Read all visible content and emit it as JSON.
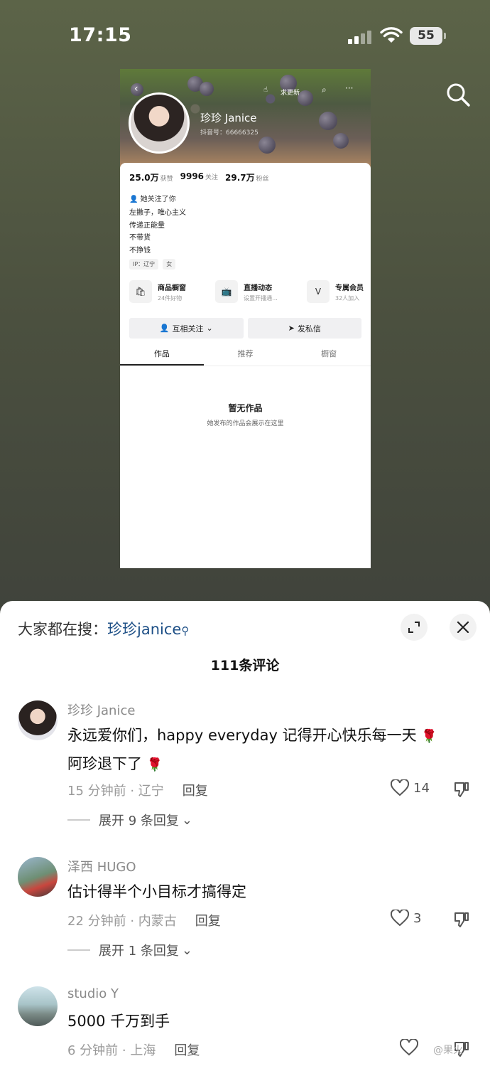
{
  "status_bar": {
    "time": "17:15",
    "battery": "55"
  },
  "profile": {
    "name": "珍珍 Janice",
    "id_label": "抖音号：66666325",
    "banner_action": "求更新",
    "stats": [
      {
        "value": "25.0万",
        "label": "获赞"
      },
      {
        "value": "9996",
        "label": "关注"
      },
      {
        "value": "29.7万",
        "label": "粉丝"
      }
    ],
    "follows_you": "她关注了你",
    "bio_lines": [
      "左撇子，唯心主义",
      "传递正能量",
      "不带货",
      "不挣钱"
    ],
    "tags": [
      "IP：辽宁",
      "女"
    ],
    "services": [
      {
        "title": "商品橱窗",
        "subtitle": "24件好物"
      },
      {
        "title": "直播动态",
        "subtitle": "设置开播通..."
      },
      {
        "title": "专属会员",
        "subtitle": "32人加入"
      }
    ],
    "buttons": {
      "mutual_follow": "互相关注",
      "message": "发私信"
    },
    "tabs": [
      "作品",
      "推荐",
      "橱窗"
    ],
    "empty_title": "暂无作品",
    "empty_subtitle": "她发布的作品会展示在这里"
  },
  "sheet": {
    "search_prefix": "大家都在搜：",
    "search_keyword": "珍珍janice",
    "comment_count": "111条评论",
    "comments": [
      {
        "name": "珍珍 Janice",
        "text_line1": "永远爱你们，happy everyday 记得开心快乐每一天",
        "text_line2": "阿珍退下了",
        "meta": "15 分钟前 · 辽宁",
        "reply": "回复",
        "likes": "14",
        "expand": "展开 9 条回复"
      },
      {
        "name": "泽西 HUGO",
        "text_line1": "估计得半个小目标才搞得定",
        "meta": "22 分钟前 · 内蒙古",
        "reply": "回复",
        "likes": "3",
        "expand": "展开 1 条回复"
      },
      {
        "name": "studio Y",
        "text_line1": "5000 千万到手",
        "meta": "6 分钟前 · 上海",
        "reply": "回复",
        "likes": ""
      }
    ]
  },
  "watermark": "@果火"
}
